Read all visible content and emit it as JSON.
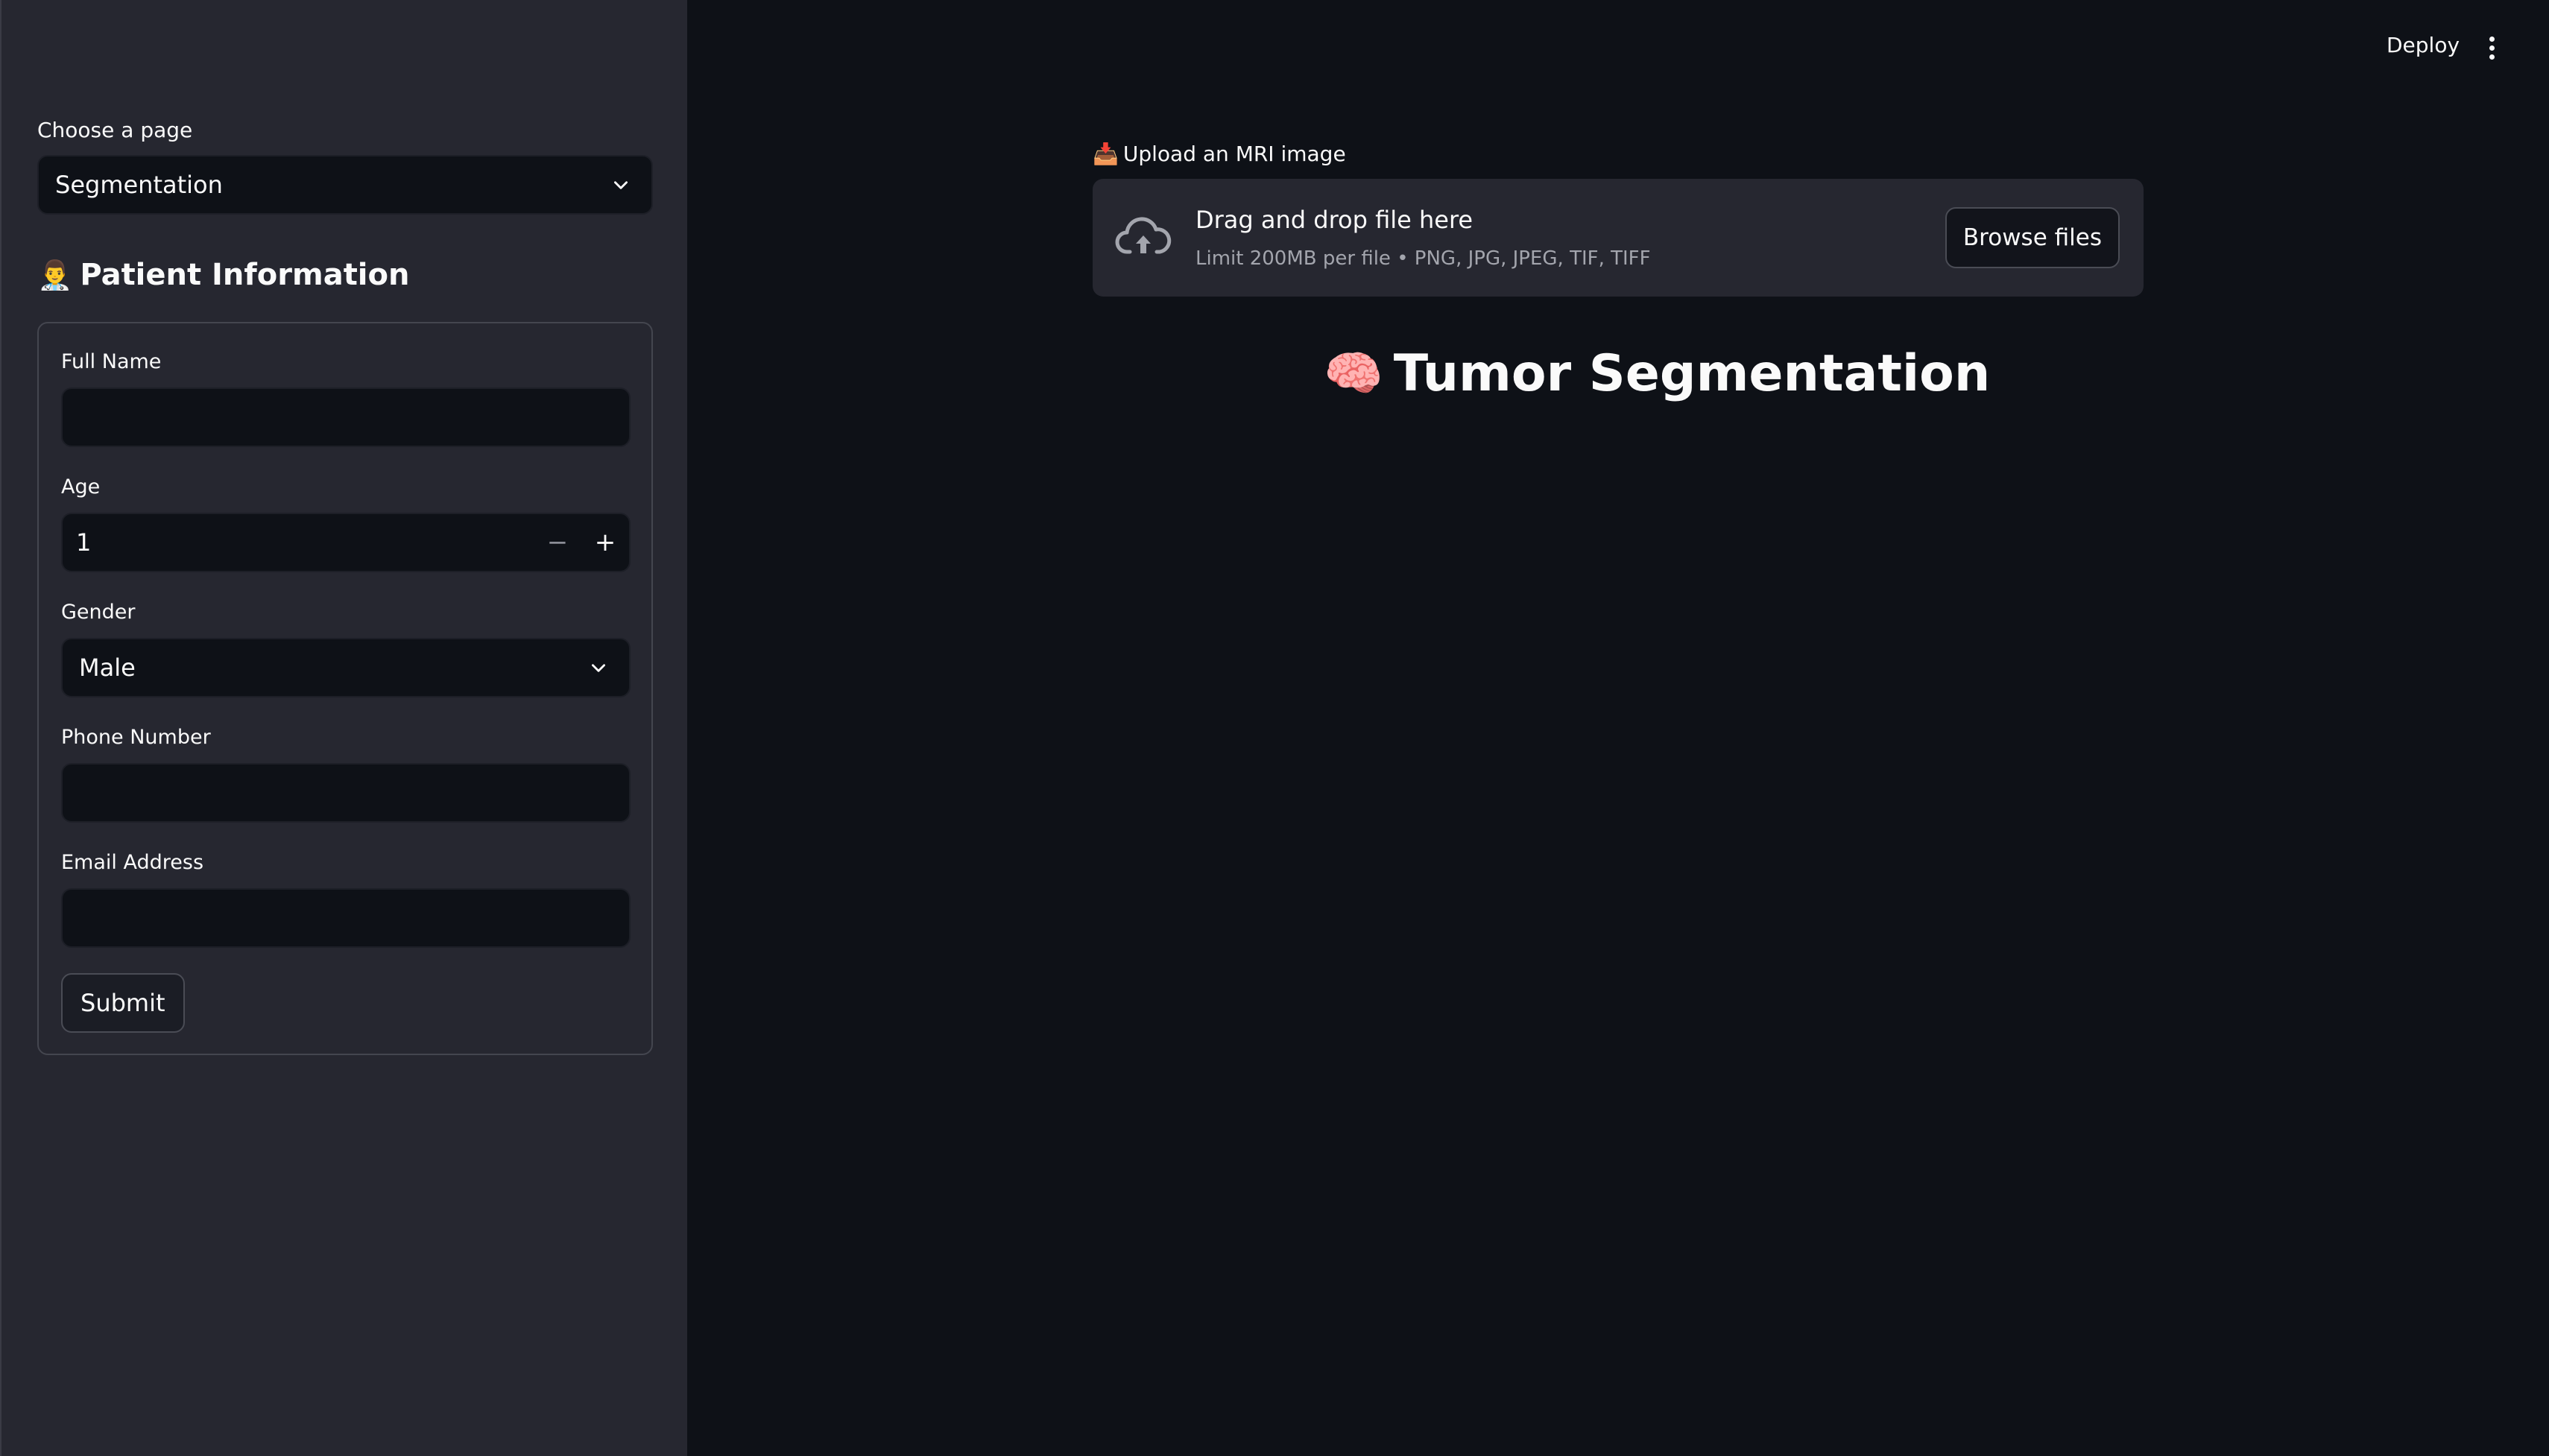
{
  "sidebar": {
    "page_select": {
      "label": "Choose a page",
      "value": "Segmentation"
    },
    "patient_info": {
      "emoji": "👨‍⚕️",
      "title": "Patient Information",
      "full_name": {
        "label": "Full Name",
        "value": ""
      },
      "age": {
        "label": "Age",
        "value": "1",
        "minus": "−",
        "plus": "+"
      },
      "gender": {
        "label": "Gender",
        "value": "Male"
      },
      "phone": {
        "label": "Phone Number",
        "value": ""
      },
      "email": {
        "label": "Email Address",
        "value": ""
      },
      "submit_label": "Submit"
    }
  },
  "header": {
    "deploy_label": "Deploy"
  },
  "main": {
    "uploader": {
      "emoji": "📥",
      "label": "Upload an MRI image",
      "drop_title": "Drag and drop file here",
      "limit_text": "Limit 200MB per file • PNG, JPG, JPEG, TIF, TIFF",
      "browse_label": "Browse files"
    },
    "title": {
      "emoji": "🧠",
      "text": "Tumor Segmentation"
    }
  },
  "colors": {
    "app_background": "#0e1117",
    "sidebar_background": "#262730",
    "text": "#fafafa"
  }
}
